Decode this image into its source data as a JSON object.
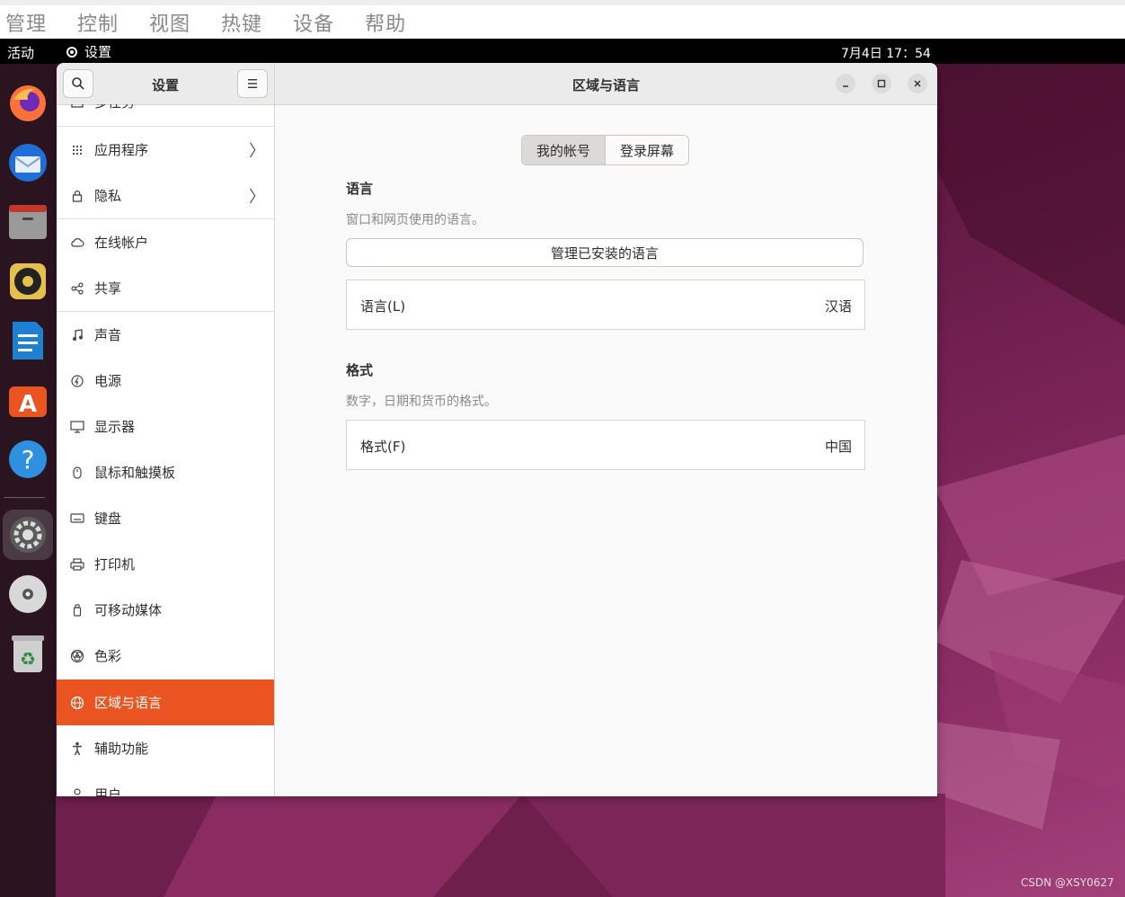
{
  "vbox_menu": [
    "管理",
    "控制",
    "视图",
    "热键",
    "设备",
    "帮助"
  ],
  "topbar": {
    "activities": "活动",
    "app_name": "设置",
    "clock": "7月4日 17：54"
  },
  "dock": [
    {
      "name": "firefox-icon"
    },
    {
      "name": "thunderbird-icon"
    },
    {
      "name": "files-icon"
    },
    {
      "name": "rhythmbox-icon"
    },
    {
      "name": "libreoffice-writer-icon"
    },
    {
      "name": "app-center-icon"
    },
    {
      "name": "help-icon"
    },
    {
      "name": "settings-icon"
    },
    {
      "name": "dvd-icon"
    },
    {
      "name": "trash-icon"
    }
  ],
  "sidebar": {
    "title": "设置",
    "items": [
      {
        "label": "多任务",
        "icon": "multitask-icon"
      },
      {
        "label": "应用程序",
        "icon": "apps-grid-icon",
        "chevron": "〉"
      },
      {
        "label": "隐私",
        "icon": "lock-icon",
        "chevron": "〉"
      },
      {
        "label": "在线帐户",
        "icon": "cloud-icon"
      },
      {
        "label": "共享",
        "icon": "share-icon"
      },
      {
        "label": "声音",
        "icon": "music-note-icon"
      },
      {
        "label": "电源",
        "icon": "power-icon"
      },
      {
        "label": "显示器",
        "icon": "display-icon"
      },
      {
        "label": "鼠标和触摸板",
        "icon": "mouse-icon"
      },
      {
        "label": "键盘",
        "icon": "keyboard-icon"
      },
      {
        "label": "打印机",
        "icon": "printer-icon"
      },
      {
        "label": "可移动媒体",
        "icon": "usb-icon"
      },
      {
        "label": "色彩",
        "icon": "color-icon"
      },
      {
        "label": "区域与语言",
        "icon": "globe-icon",
        "selected": true
      },
      {
        "label": "辅助功能",
        "icon": "accessibility-icon"
      },
      {
        "label": "用户",
        "icon": "users-icon"
      }
    ]
  },
  "main": {
    "title": "区域与语言",
    "tabs": [
      {
        "label": "我的帐号",
        "active": true
      },
      {
        "label": "登录屏幕",
        "active": false
      }
    ],
    "language": {
      "heading": "语言",
      "subtitle": "窗口和网页使用的语言。",
      "manage_button": "管理已安装的语言",
      "row_label": "语言(L)",
      "row_value": "汉语"
    },
    "formats": {
      "heading": "格式",
      "subtitle": "数字，日期和货币的格式。",
      "row_label": "格式(F)",
      "row_value": "中国"
    }
  },
  "watermark": "CSDN @XSY0627",
  "colors": {
    "accent": "#e95420",
    "topbar": "#000000",
    "dock": "#2a1420"
  }
}
